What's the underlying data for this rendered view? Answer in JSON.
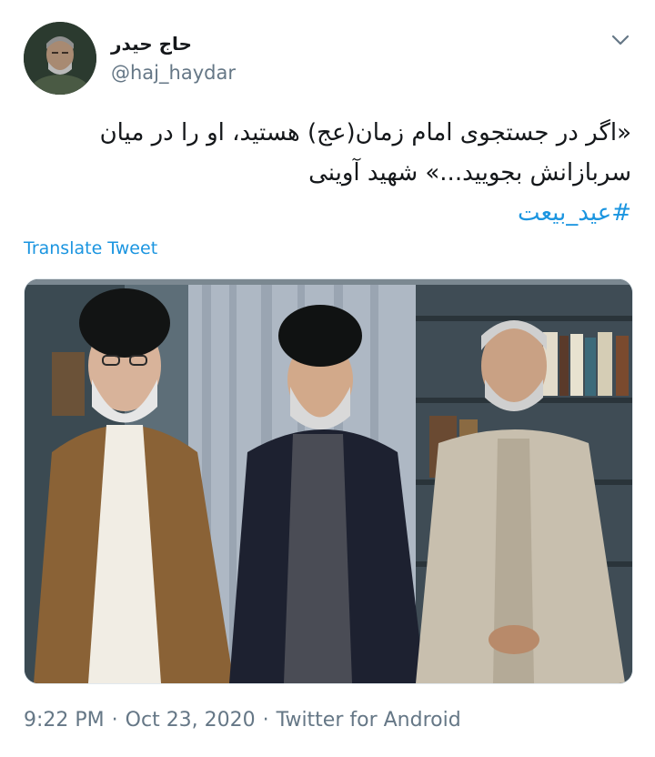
{
  "user": {
    "display_name": "حاج حیدر",
    "handle": "@haj_haydar"
  },
  "tweet": {
    "line1": "«اگر در جستجوی امام زمان(عج) هستید، او را در میان",
    "line2": "سربازانش بجویید...» شهید آوینی",
    "hashtag": "#عید_بیعت",
    "translate_label": "Translate Tweet"
  },
  "meta": {
    "time": "9:22 PM",
    "date": "Oct 23, 2020",
    "separator": "·",
    "source": "Twitter for Android"
  },
  "colors": {
    "link": "#1b95e0",
    "secondary_text": "#657786",
    "primary_text": "#14171a"
  },
  "icons": {
    "menu": "chevron-down-icon"
  }
}
